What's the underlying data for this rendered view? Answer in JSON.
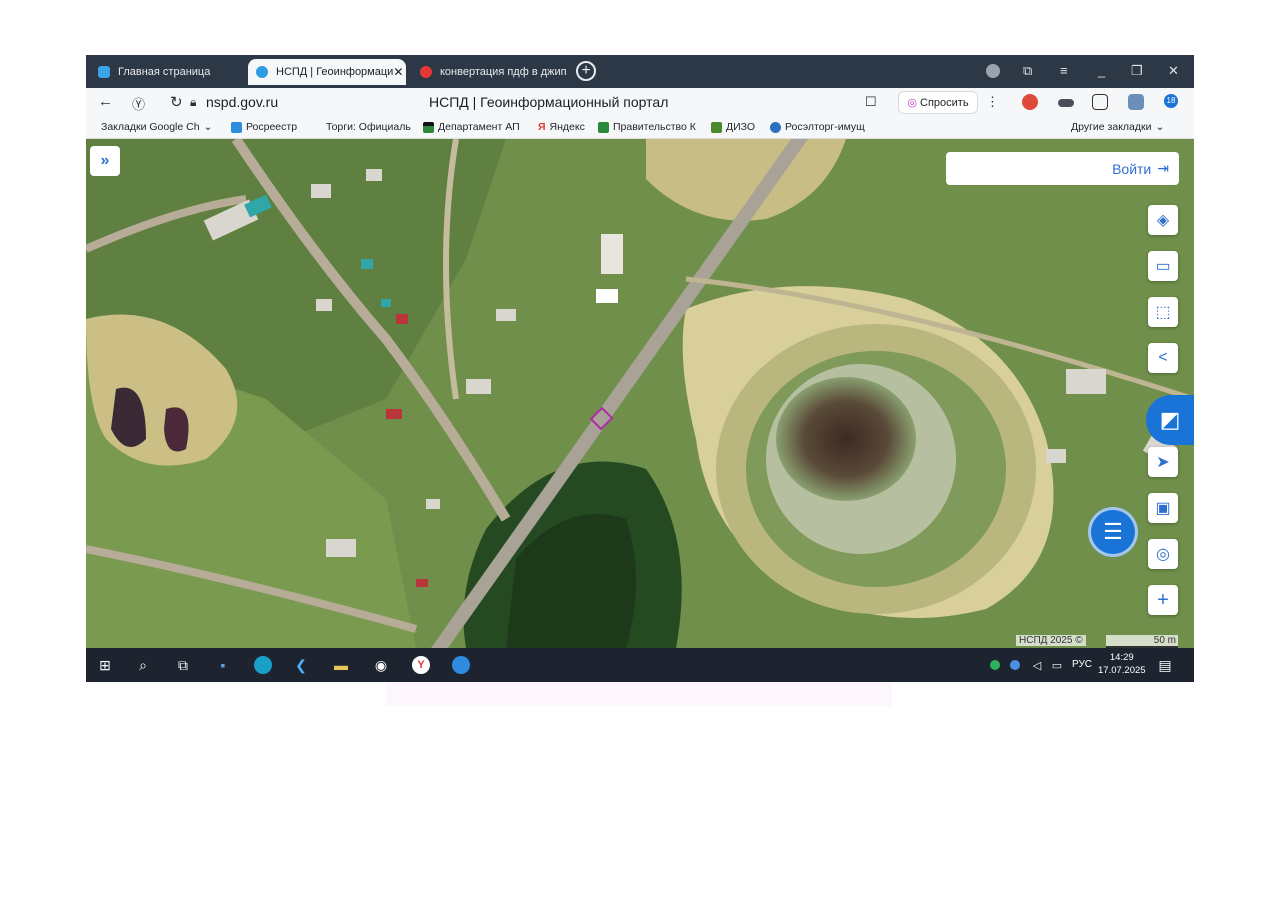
{
  "browser": {
    "tabs": [
      {
        "label": "Главная страница",
        "active": false
      },
      {
        "label": "НСПД | Геоинформаци",
        "active": true,
        "close": "✕"
      },
      {
        "label": "конвертация пдф в джип",
        "active": false
      }
    ],
    "new_tab": "+",
    "address": {
      "url": "nspd.gov.ru",
      "page_title": "НСПД | Геоинформационный портал",
      "ask_label": "Спросить",
      "menu": "⋮"
    },
    "bookmarks": [
      {
        "label": "Закладки Google Ch",
        "icon": "folder-icon"
      },
      {
        "label": "Росреестр",
        "icon": "rosreestr-icon",
        "color": "#2c8de0"
      },
      {
        "label": "Торги: Официаль",
        "icon": "gov-icon"
      },
      {
        "label": "Департамент АП",
        "icon": "flag-icon",
        "color": "#2a8a3a"
      },
      {
        "label": "Яндекс",
        "icon": "yandex-icon",
        "color": "#e53935"
      },
      {
        "label": "Правительство К",
        "icon": "gov-icon",
        "color": "#2a8a3a"
      },
      {
        "label": "ДИЗО",
        "icon": "dizo-icon",
        "color": "#4a8a2a"
      },
      {
        "label": "Росэлторг-имущ",
        "icon": "roseltorg-icon",
        "color": "#2c6fc0"
      }
    ],
    "other_bookmarks": "Другие закладки",
    "ext_badge": "18"
  },
  "map": {
    "login_label": "Войти",
    "attribution": "НСПД 2025 ©",
    "scale_label": "50 m",
    "controls": [
      "layers-icon",
      "ruler-icon",
      "select-area-icon",
      "share-icon",
      "geolocate-icon",
      "print-icon",
      "search-location-icon",
      "zoom-in-icon"
    ]
  },
  "taskbar": {
    "time": "14:29",
    "date": "17.07.2025",
    "lang": "РУС"
  },
  "colors": {
    "accent": "#1a73d6",
    "parcel_outline": "#b02ca8"
  }
}
